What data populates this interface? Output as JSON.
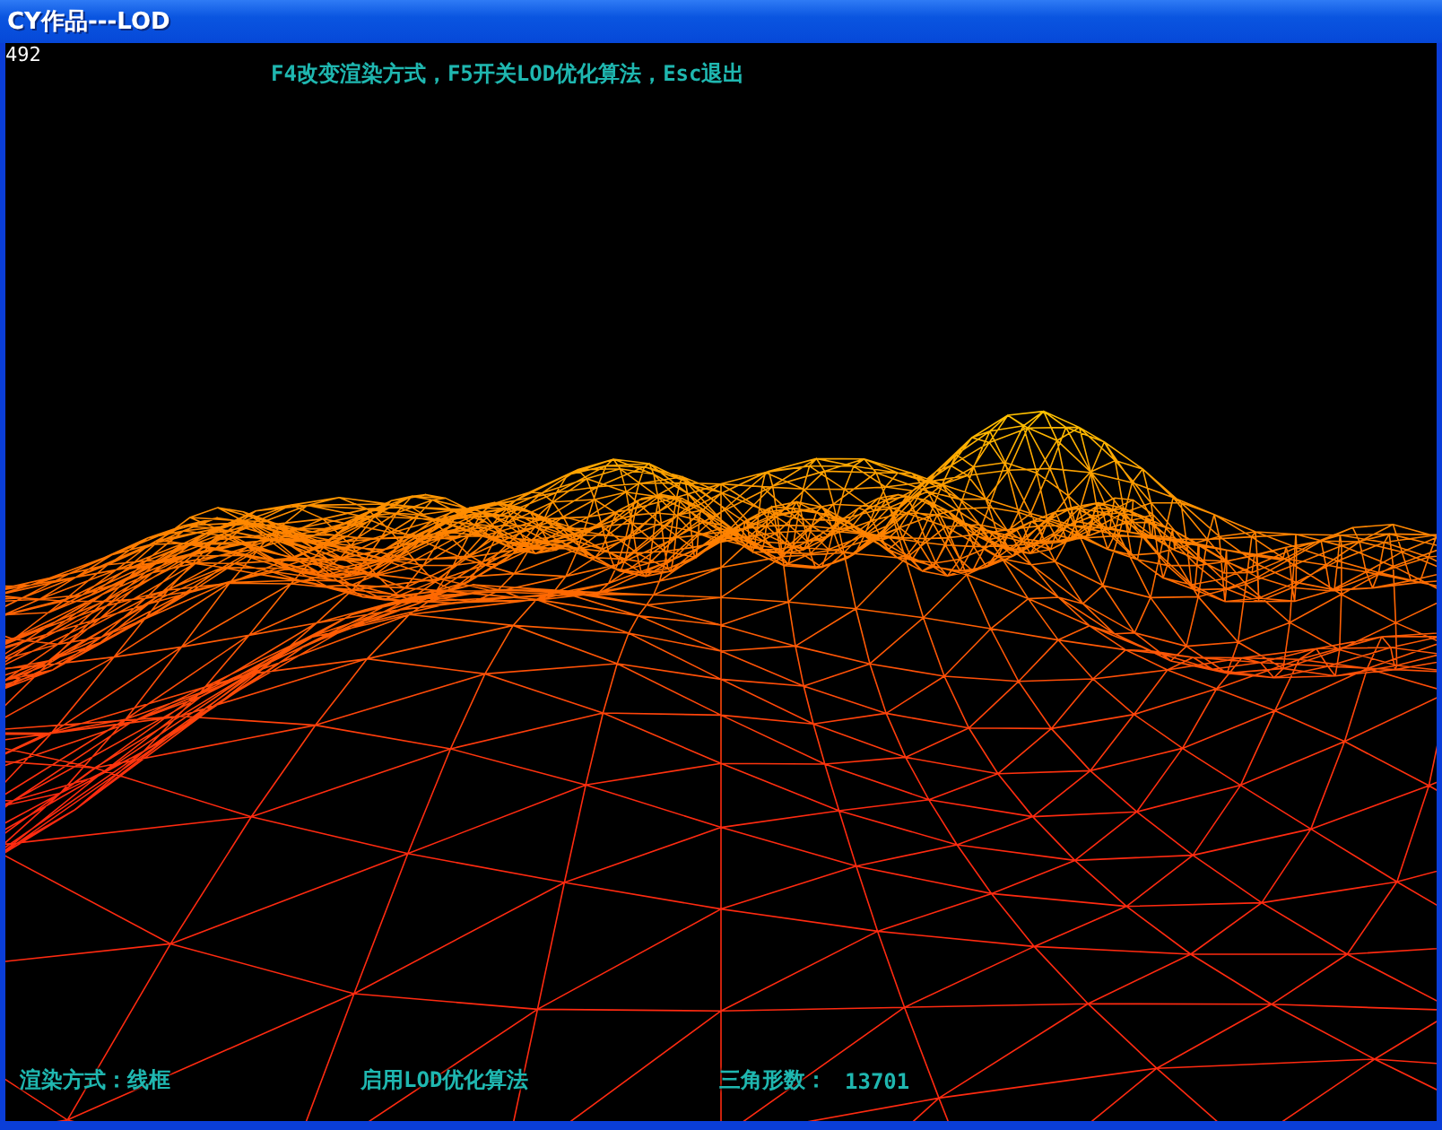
{
  "window": {
    "title": "CY作品---LOD"
  },
  "overlay": {
    "fps": "492",
    "help": "F4改变渲染方式，F5开关LOD优化算法，Esc退出"
  },
  "status": {
    "render_mode": "渲染方式：线框",
    "lod": "启用LOD优化算法",
    "triangle_label": "三角形数：",
    "triangle_count": "13701"
  }
}
